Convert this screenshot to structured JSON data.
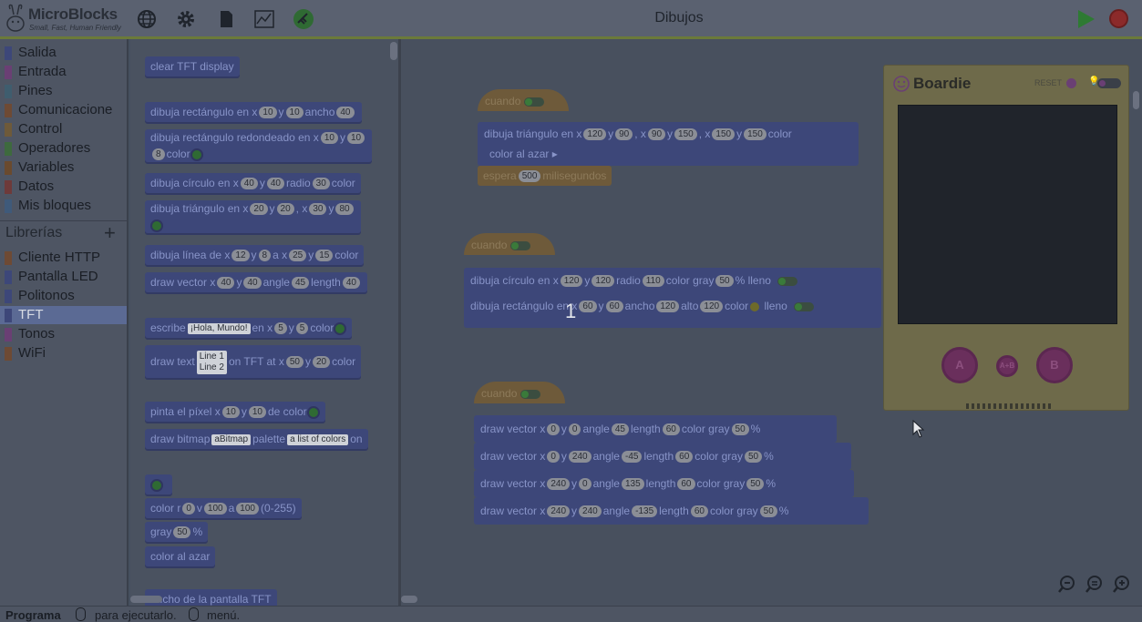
{
  "app": {
    "name": "MicroBlocks",
    "tagline": "Small, Fast, Human Friendly",
    "project_title": "Dibujos"
  },
  "toolbar": {
    "icons": [
      "globe-icon",
      "gear-icon",
      "file-icon",
      "graph-icon",
      "usb-connection-icon"
    ],
    "run_icon": "play-icon",
    "stop_icon": "stop-icon"
  },
  "categories": [
    {
      "label": "Salida",
      "color": "#3d4779"
    },
    {
      "label": "Entrada",
      "color": "#6a3f74"
    },
    {
      "label": "Pines",
      "color": "#3f5d6e"
    },
    {
      "label": "Comunicacione",
      "color": "#6e4a34"
    },
    {
      "label": "Control",
      "color": "#6e5a3a"
    },
    {
      "label": "Operadores",
      "color": "#3e6a3e"
    },
    {
      "label": "Variables",
      "color": "#6a4a2e"
    },
    {
      "label": "Datos",
      "color": "#6e3a3a"
    },
    {
      "label": "Mis bloques",
      "color": "#3f5a7a"
    }
  ],
  "libraries": {
    "header": "Librerías",
    "add": "+",
    "items": [
      {
        "label": "Cliente HTTP",
        "color": "#6e4a34"
      },
      {
        "label": "Pantalla LED",
        "color": "#3d4779"
      },
      {
        "label": "Politonos",
        "color": "#3d4779"
      },
      {
        "label": "TFT",
        "color": "#3d4779",
        "selected": true
      },
      {
        "label": "Tonos",
        "color": "#6a3f74"
      },
      {
        "label": "WiFi",
        "color": "#6e4a34"
      }
    ]
  },
  "palette": {
    "clear": "clear TFT display",
    "rect": {
      "t1": "dibuja rectángulo en x",
      "x": "10",
      "t2": "y",
      "y": "10",
      "t3": "ancho",
      "w": "40"
    },
    "rrect": {
      "t1": "dibuja rectángulo redondeado en x",
      "x": "10",
      "t2": "y",
      "y": "10",
      "r": "8",
      "t3": "color"
    },
    "circle": {
      "t1": "dibuja círculo en x",
      "x": "40",
      "t2": "y",
      "y": "40",
      "t3": "radio",
      "r": "30",
      "t4": "color"
    },
    "tri": {
      "t1": "dibuja triángulo en x",
      "x1": "20",
      "t2": "y",
      "y1": "20",
      "t3": ", x",
      "x2": "30",
      "t4": "y",
      "y2": "80"
    },
    "line": {
      "t1": "dibuja línea de x",
      "x1": "12",
      "t2": "y",
      "y1": "8",
      "t3": "a x",
      "x2": "25",
      "t4": "y",
      "y2": "15",
      "t5": "color"
    },
    "vector": {
      "t1": "draw vector x",
      "x": "40",
      "t2": "y",
      "y": "40",
      "t3": "angle",
      "a": "45",
      "t4": "length",
      "l": "40"
    },
    "write": {
      "t1": "escribe",
      "txt": "¡Hola, Mundo!",
      "t2": "en x",
      "x": "5",
      "t3": "y",
      "y": "5",
      "t4": "color"
    },
    "drawtext": {
      "t1": "draw text",
      "l1": "Line 1",
      "l2": "Line 2",
      "t2": "on TFT at x",
      "x": "50",
      "t3": "y",
      "y": "20",
      "t4": "color"
    },
    "pixel": {
      "t1": "pinta el píxel x",
      "x": "10",
      "t2": "y",
      "y": "10",
      "t3": "de color"
    },
    "bitmap": {
      "t1": "draw bitmap",
      "b": "aBitmap",
      "t2": "palette",
      "p": "a list of colors",
      "t3": "on"
    },
    "rgb": {
      "t1": "color r",
      "r": "0",
      "t2": "v",
      "g": "100",
      "t3": "a",
      "b": "100",
      "t4": "(0-255)"
    },
    "gray": {
      "t1": "gray",
      "v": "50",
      "t2": "%"
    },
    "random": "color al azar",
    "width": "ancho de la pantalla TFT"
  },
  "scripts": {
    "s1": {
      "hat": "cuando",
      "tri": {
        "t1": "dibuja triángulo en x",
        "x1": "120",
        "t2": "y",
        "y1": "90",
        "t3": ", x",
        "x2": "90",
        "t4": "y",
        "y2": "150",
        "t5": ", x",
        "x3": "150",
        "t6": "y",
        "y3": "150",
        "t7": "color"
      },
      "rand": "color al azar",
      "wait": {
        "t1": "espera",
        "ms": "500",
        "t2": "milisegundos"
      }
    },
    "s2": {
      "hat": "cuando",
      "circle": {
        "t1": "dibuja círculo en x",
        "x": "120",
        "t2": "y",
        "y": "120",
        "t3": "radio",
        "r": "110",
        "t4": "color",
        "t5": "gray",
        "g": "50",
        "t6": "%",
        "t7": "lleno"
      },
      "rect": {
        "t1": "dibuja rectángulo en x",
        "x": "60",
        "t2": "y",
        "y": "60",
        "t3": "ancho",
        "w": "120",
        "t4": "alto",
        "h": "120",
        "t5": "color",
        "t6": "lleno"
      }
    },
    "s3": {
      "hat": "cuando",
      "rows": [
        {
          "t1": "draw vector x",
          "x": "0",
          "t2": "y",
          "y": "0",
          "t3": "angle",
          "a": "45",
          "t4": "length",
          "l": "60",
          "t5": "color",
          "t6": "gray",
          "g": "50",
          "t7": "%"
        },
        {
          "t1": "draw vector x",
          "x": "0",
          "t2": "y",
          "y": "240",
          "t3": "angle",
          "a": "-45",
          "t4": "length",
          "l": "60",
          "t5": "color",
          "t6": "gray",
          "g": "50",
          "t7": "%"
        },
        {
          "t1": "draw vector x",
          "x": "240",
          "t2": "y",
          "y": "0",
          "t3": "angle",
          "a": "135",
          "t4": "length",
          "l": "60",
          "t5": "color",
          "t6": "gray",
          "g": "50",
          "t7": "%"
        },
        {
          "t1": "draw vector x",
          "x": "240",
          "t2": "y",
          "y": "240",
          "t3": "angle",
          "a": "-135",
          "t4": "length",
          "l": "60",
          "t5": "color",
          "t6": "gray",
          "g": "50",
          "t7": "%"
        }
      ]
    }
  },
  "overlay_number": "1",
  "boardie": {
    "name": "Boardie",
    "reset": "RESET",
    "btn_a": "A",
    "btn_ab": "A+B",
    "btn_b": "B"
  },
  "zoom": [
    "zoom-out-icon",
    "zoom-reset-icon",
    "zoom-in-icon"
  ],
  "status": {
    "bold": "Programa",
    "t1": "para ejecutarlo.",
    "t2": "menú."
  }
}
